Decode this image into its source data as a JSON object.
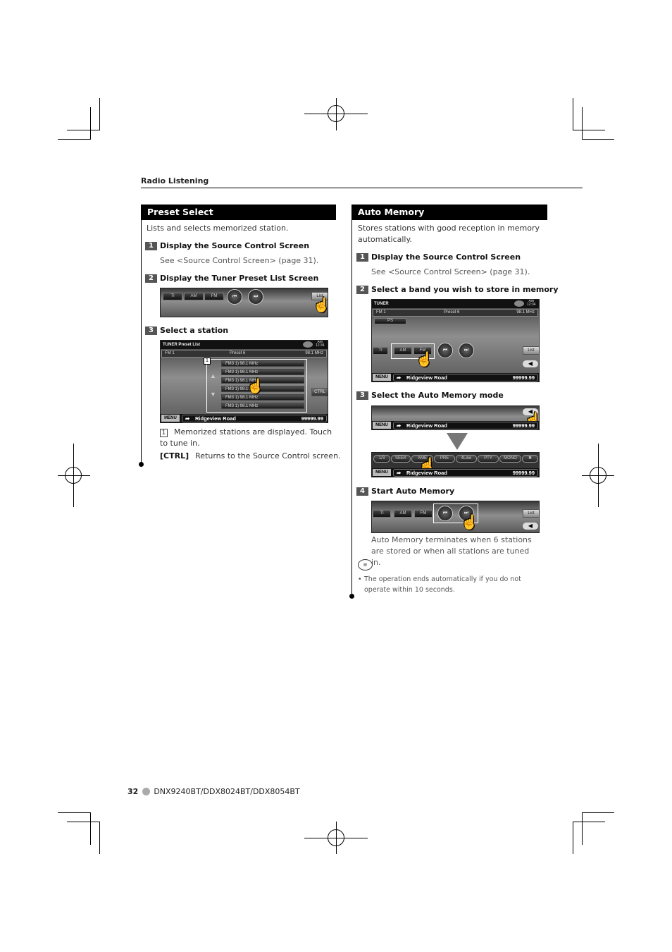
{
  "header": {
    "section": "Radio Listening"
  },
  "preset_select": {
    "title": "Preset Select",
    "intro": "Lists and selects memorized station.",
    "steps": [
      {
        "num": "1",
        "title": "Display the Source Control Screen",
        "note": "See <Source Control Screen> (page 31)."
      },
      {
        "num": "2",
        "title": "Display the Tuner Preset List Screen"
      },
      {
        "num": "3",
        "title": "Select a station"
      }
    ],
    "screen_buttons": {
      "ti": "TI",
      "am": "AM",
      "fm": "FM",
      "list": "List",
      "prev": "⏮",
      "next": "⏭"
    },
    "preset_list": {
      "title": "TUNER Preset List",
      "clock_ampm": "AM",
      "clock": "12:34",
      "band": "FM 1",
      "preset": "Preset 6",
      "freq": "98.1 MHz",
      "callout": "1",
      "rows": [
        "FM3 1)  98.1 MHz",
        "FM3 1)  98.1 MHz",
        "FM3 1)  98.1 MHz",
        "FM3 1)  98.1 MHz",
        "FM3 1)  98.1 MHz",
        "FM3 1)  98.1 MHz"
      ],
      "ctrl": "CTRL",
      "menu": "MENU",
      "road": "Ridgeview Road",
      "distance": "99999.99"
    },
    "notes": [
      {
        "key": "1",
        "text": "Memorized stations are displayed. Touch to tune in."
      },
      {
        "key": "[CTRL]",
        "text": "Returns to the Source Control screen."
      }
    ]
  },
  "auto_memory": {
    "title": "Auto Memory",
    "intro": "Stores stations with good reception in memory automatically.",
    "steps": [
      {
        "num": "1",
        "title": "Display the Source Control Screen",
        "note": "See <Source Control Screen> (page 31)."
      },
      {
        "num": "2",
        "title": "Select a band you wish to store in memory"
      },
      {
        "num": "3",
        "title": "Select the Auto Memory mode"
      },
      {
        "num": "4",
        "title": "Start Auto Memory"
      }
    ],
    "tuner_screen": {
      "title": "TUNER",
      "clock_ampm": "AM",
      "clock": "12:34",
      "band": "FM 1",
      "preset": "Preset 6",
      "freq": "98.1 MHz",
      "ps": "PS"
    },
    "function_bar": [
      "1/3",
      "SEEK",
      "AME",
      "PRE",
      "4Line",
      "PTY",
      "MONO"
    ],
    "result": "Auto Memory terminates when 6 stations are stored or when all stations are tuned in.",
    "tip": "The operation ends automatically if you do not operate within 10 seconds."
  },
  "footer": {
    "page": "32",
    "models": "DNX9240BT/DDX8024BT/DDX8054BT"
  }
}
